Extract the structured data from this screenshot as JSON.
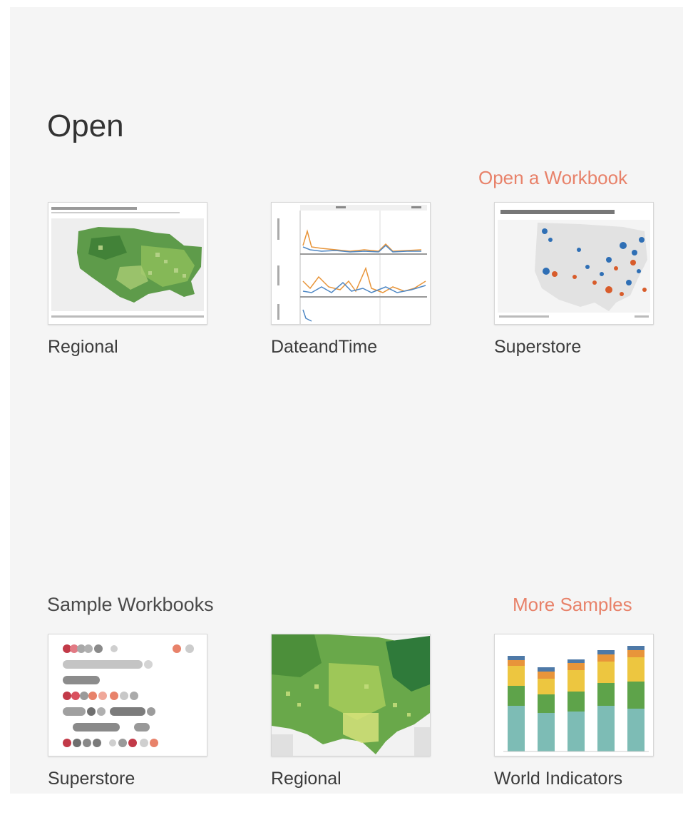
{
  "open": {
    "heading": "Open",
    "open_link": "Open a Workbook",
    "workbooks": [
      {
        "name": "Regional",
        "thumbnail": "choropleth-map-thumbnail"
      },
      {
        "name": "DateandTime",
        "thumbnail": "line-chart-thumbnail"
      },
      {
        "name": "Superstore",
        "thumbnail": "profitability-map-thumbnail"
      }
    ]
  },
  "samples": {
    "title": "Sample Workbooks",
    "more_link": "More Samples",
    "workbooks": [
      {
        "name": "Superstore",
        "thumbnail": "dot-plot-thumbnail"
      },
      {
        "name": "Regional",
        "thumbnail": "green-map-thumbnail"
      },
      {
        "name": "World Indicators",
        "thumbnail": "stacked-bar-thumbnail"
      }
    ]
  },
  "colors": {
    "link": "#e8826a",
    "panel_bg": "#f5f5f5",
    "text": "#3c3c3c"
  }
}
